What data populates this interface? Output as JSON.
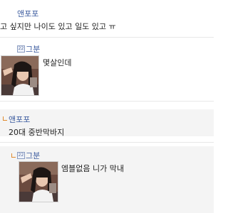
{
  "comments": [
    {
      "nick": "앤포포",
      "text": "고 싶지만 나이도 있고 일도 있고 ㅠ"
    },
    {
      "nick": "그분",
      "text": "몇살인데",
      "badge": "22"
    },
    {
      "nick": "앤포포",
      "text": "20대 중반막바지"
    },
    {
      "nick": "그분",
      "text": "엠블없음 니가 막내",
      "badge": "22"
    }
  ]
}
